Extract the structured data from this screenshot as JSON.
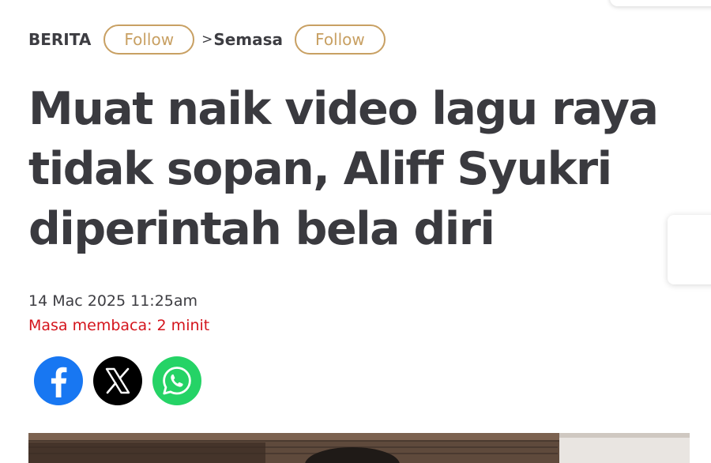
{
  "breadcrumb": {
    "category": "BERITA",
    "separator": ">",
    "subcategory": "Semasa",
    "follow_label_1": "Follow",
    "follow_label_2": "Follow"
  },
  "article": {
    "headline_lines": [
      "Muat naik video lagu raya",
      "tidak sopan, Aliff Syukri",
      "diperintah bela diri"
    ],
    "date": "14 Mac 2025 11:25am",
    "reading_time": "Masa membaca: 2 minit"
  },
  "share": {
    "icons": [
      "facebook-icon",
      "x-icon",
      "whatsapp-icon"
    ]
  },
  "colors": {
    "accent_gold": "#c8a063",
    "headline": "#3a3a3f",
    "reading_time_red": "#d4141c",
    "facebook": "#1877f2",
    "x": "#000000",
    "whatsapp": "#25d366"
  }
}
